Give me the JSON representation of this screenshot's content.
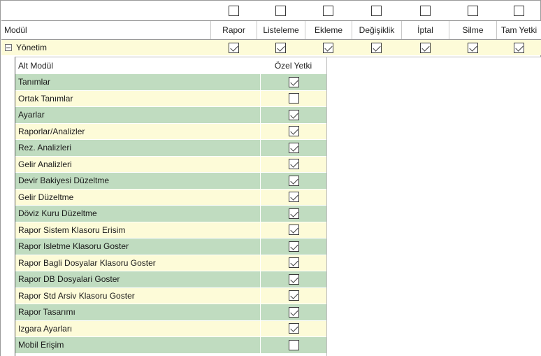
{
  "columns": [
    {
      "key": "rapor",
      "label": "Rapor",
      "header_checked": false,
      "module_checked": true
    },
    {
      "key": "listeleme",
      "label": "Listeleme",
      "header_checked": false,
      "module_checked": true
    },
    {
      "key": "ekleme",
      "label": "Ekleme",
      "header_checked": false,
      "module_checked": true
    },
    {
      "key": "degisiklik",
      "label": "Değişiklik",
      "header_checked": false,
      "module_checked": true
    },
    {
      "key": "iptal",
      "label": "İptal",
      "header_checked": false,
      "module_checked": true
    },
    {
      "key": "silme",
      "label": "Silme",
      "header_checked": false,
      "module_checked": true
    },
    {
      "key": "tam_yetki",
      "label": "Tam Yetki",
      "header_checked": false,
      "module_checked": true
    }
  ],
  "header": {
    "modul_label": "Modül"
  },
  "module": {
    "name": "Yönetim",
    "expanded": true
  },
  "sub_grid": {
    "col_name": "Alt Modül",
    "col_check": "Özel Yetki",
    "rows": [
      {
        "name": "Tanımlar",
        "checked": true
      },
      {
        "name": "Ortak Tanımlar",
        "checked": false
      },
      {
        "name": "Ayarlar",
        "checked": true
      },
      {
        "name": "Raporlar/Analizler",
        "checked": true
      },
      {
        "name": "Rez. Analizleri",
        "checked": true
      },
      {
        "name": "Gelir Analizleri",
        "checked": true
      },
      {
        "name": "Devir Bakiyesi Düzeltme",
        "checked": true
      },
      {
        "name": "Gelir Düzeltme",
        "checked": true
      },
      {
        "name": "Döviz Kuru Düzeltme",
        "checked": true
      },
      {
        "name": "Rapor Sistem Klasoru Erisim",
        "checked": true
      },
      {
        "name": "Rapor Isletme Klasoru Goster",
        "checked": true
      },
      {
        "name": "Rapor Bagli Dosyalar Klasoru Goster",
        "checked": true
      },
      {
        "name": "Rapor DB Dosyalari Goster",
        "checked": true
      },
      {
        "name": "Rapor Std Arsiv Klasoru Goster",
        "checked": true
      },
      {
        "name": "Rapor Tasarımı",
        "checked": true
      },
      {
        "name": "Izgara Ayarları",
        "checked": true
      },
      {
        "name": "Mobil Erişim",
        "checked": false
      }
    ]
  },
  "colors": {
    "row_green": "#c0dcc0",
    "row_cream": "#fdfbd8",
    "grid_line": "#9a9a9a"
  }
}
